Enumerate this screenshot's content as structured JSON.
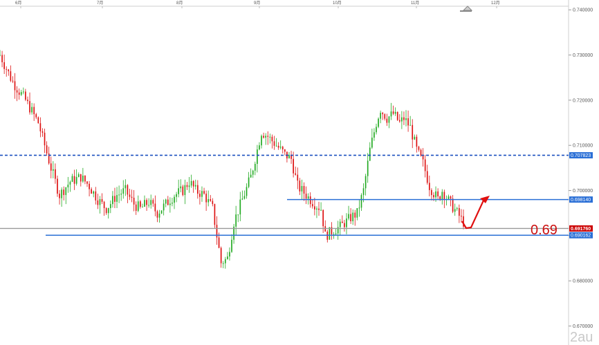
{
  "chart_data": {
    "type": "candlestick",
    "title": "",
    "xlabel": "",
    "ylabel": "",
    "ylim": [
      0.6658,
      0.7408
    ],
    "x_ticks": [
      "6月",
      "7月",
      "8月",
      "9月",
      "10月",
      "11月",
      "12月"
    ],
    "y_ticks": [
      "0.740000",
      "0.730000",
      "0.720000",
      "0.710000",
      "0.700000",
      "0.690000",
      "0.680000",
      "0.670000"
    ],
    "grid": false,
    "up_color": "#22aa22",
    "down_color": "#dd1111",
    "candles": [],
    "levels": [
      {
        "value": 0.7078,
        "label": "0.707823",
        "style": "dashed",
        "color": "#1a4fbf"
      },
      {
        "value": 0.698,
        "label": "0.698140",
        "style": "solid",
        "color": "#2a6fd6"
      },
      {
        "value": 0.6916,
        "label": "0.691760",
        "style": "solid",
        "color": "#999999",
        "tag_color": "#cc0000"
      },
      {
        "value": 0.6901,
        "label": "0.690162",
        "style": "solid",
        "color": "#2a6fd6"
      }
    ],
    "annotations": [
      {
        "text": "0.69",
        "color": "#cc1111"
      }
    ]
  },
  "watermark": "2au"
}
